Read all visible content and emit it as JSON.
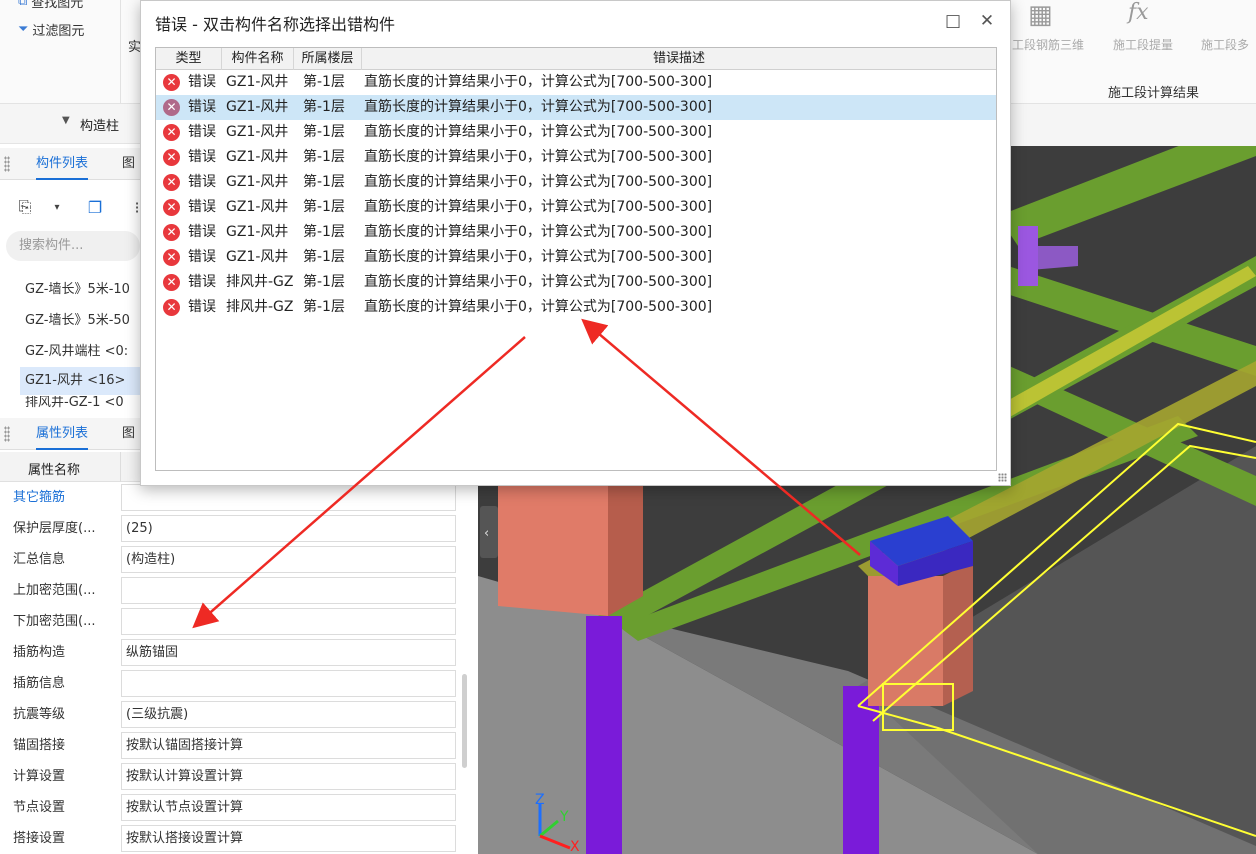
{
  "ribbon": {
    "find_label": "查找图元",
    "filter_label": "过滤图元",
    "partial_label": "实",
    "tools": [
      "工段钢筋三维",
      "施工段提量",
      "施工段多"
    ],
    "group_label": "施工段计算结果",
    "fx_icon_text": "fx"
  },
  "left": {
    "component_type": "构造柱",
    "tabs_top": [
      "构件列表",
      "图"
    ],
    "search_placeholder": "搜索构件...",
    "components": [
      "GZ-墙长》5米-10",
      "GZ-墙长》5米-50",
      "GZ-风井端柱 <0:",
      "GZ1-风井 <16>",
      "排风井-GZ-1 <0"
    ],
    "tabs_bottom": [
      "属性列表",
      "图"
    ],
    "prop_header": "属性名称",
    "properties": [
      {
        "name": "其它箍筋",
        "value": ""
      },
      {
        "name": "保护层厚度(...",
        "value": "(25)"
      },
      {
        "name": "汇总信息",
        "value": "(构造柱)"
      },
      {
        "name": "上加密范围(...",
        "value": ""
      },
      {
        "name": "下加密范围(...",
        "value": ""
      },
      {
        "name": "插筋构造",
        "value": "纵筋锚固"
      },
      {
        "name": "插筋信息",
        "value": ""
      },
      {
        "name": "抗震等级",
        "value": "(三级抗震)"
      },
      {
        "name": "锚固搭接",
        "value": "按默认锚固搭接计算"
      },
      {
        "name": "计算设置",
        "value": "按默认计算设置计算"
      },
      {
        "name": "节点设置",
        "value": "按默认节点设置计算"
      },
      {
        "name": "搭接设置",
        "value": "按默认搭接设置计算"
      }
    ]
  },
  "dialog": {
    "title": "错误 - 双击构件名称选择出错构件",
    "minimize": "□",
    "close": "✕",
    "columns": [
      "类型",
      "构件名称",
      "所属楼层",
      "错误描述"
    ],
    "rows": [
      {
        "type": "错误",
        "name": "GZ1-风井",
        "floor": "第-1层",
        "desc": "直筋长度的计算结果小于0，计算公式为[700-500-300]"
      },
      {
        "type": "错误",
        "name": "GZ1-风井",
        "floor": "第-1层",
        "desc": "直筋长度的计算结果小于0，计算公式为[700-500-300]"
      },
      {
        "type": "错误",
        "name": "GZ1-风井",
        "floor": "第-1层",
        "desc": "直筋长度的计算结果小于0，计算公式为[700-500-300]"
      },
      {
        "type": "错误",
        "name": "GZ1-风井",
        "floor": "第-1层",
        "desc": "直筋长度的计算结果小于0，计算公式为[700-500-300]"
      },
      {
        "type": "错误",
        "name": "GZ1-风井",
        "floor": "第-1层",
        "desc": "直筋长度的计算结果小于0，计算公式为[700-500-300]"
      },
      {
        "type": "错误",
        "name": "GZ1-风井",
        "floor": "第-1层",
        "desc": "直筋长度的计算结果小于0，计算公式为[700-500-300]"
      },
      {
        "type": "错误",
        "name": "GZ1-风井",
        "floor": "第-1层",
        "desc": "直筋长度的计算结果小于0，计算公式为[700-500-300]"
      },
      {
        "type": "错误",
        "name": "GZ1-风井",
        "floor": "第-1层",
        "desc": "直筋长度的计算结果小于0，计算公式为[700-500-300]"
      },
      {
        "type": "错误",
        "name": "排风井-GZ",
        "floor": "第-1层",
        "desc": "直筋长度的计算结果小于0，计算公式为[700-500-300]"
      },
      {
        "type": "错误",
        "name": "排风井-GZ",
        "floor": "第-1层",
        "desc": "直筋长度的计算结果小于0，计算公式为[700-500-300]"
      }
    ],
    "selected_row": 1
  },
  "viewport": {
    "axis_labels": [
      "Z",
      "Y",
      "X"
    ]
  },
  "colors": {
    "accent": "#1a6fd6",
    "error": "#e8383d",
    "selection": "#cde6f7",
    "annotation_arrow": "#ee2a24"
  }
}
